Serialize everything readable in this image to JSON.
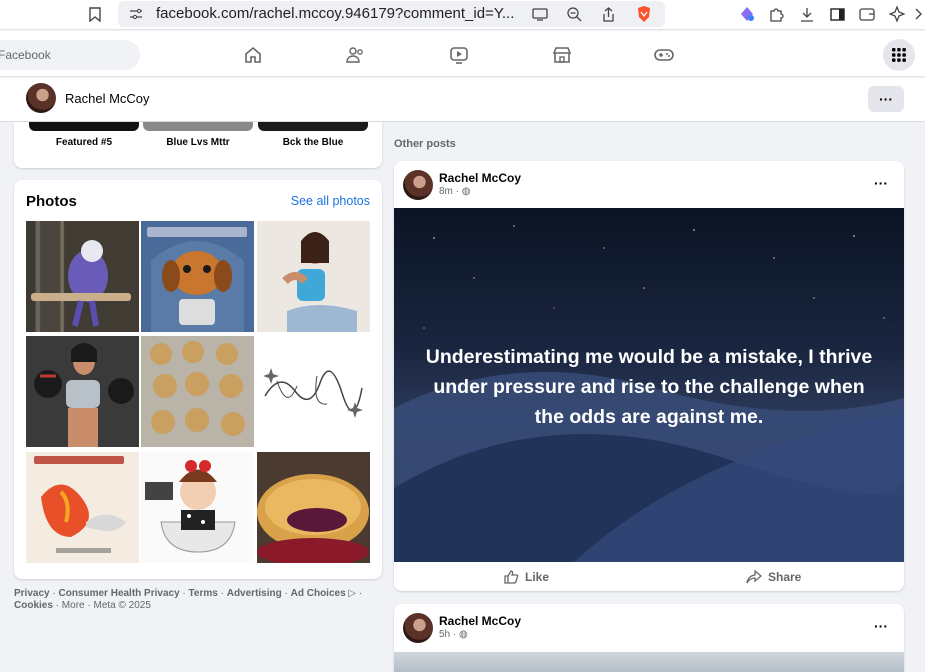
{
  "browser": {
    "url": "facebook.com/rachel.mccoy.946179?comment_id=Y..."
  },
  "nav": {
    "search_placeholder": "Facebook"
  },
  "profile": {
    "name": "Rachel McCoy",
    "more": "···"
  },
  "featured": {
    "items": [
      {
        "label": "Featured #5"
      },
      {
        "label": "Blue Lvs Mttr"
      },
      {
        "label": "Bck the Blue"
      }
    ]
  },
  "photos": {
    "title": "Photos",
    "see_all": "See all photos"
  },
  "footer": {
    "links": [
      "Privacy",
      "Consumer Health Privacy",
      "Terms",
      "Advertising",
      "Ad Choices",
      "Cookies"
    ],
    "more": "More",
    "copyright": "Meta © 2025"
  },
  "feed": {
    "section_label": "Other posts",
    "posts": [
      {
        "author": "Rachel McCoy",
        "time": "8m",
        "quote": "Underestimating me would be a mistake, I thrive under pressure and rise to the challenge when the odds are against me.",
        "like": "Like",
        "share": "Share"
      },
      {
        "author": "Rachel McCoy",
        "time": "5h"
      }
    ],
    "more": "···"
  },
  "colors": {
    "link": "#1b74e4",
    "page_bg": "#f0f2f5",
    "card_bg": "#ffffff",
    "brave_orange": "#fb542b"
  }
}
